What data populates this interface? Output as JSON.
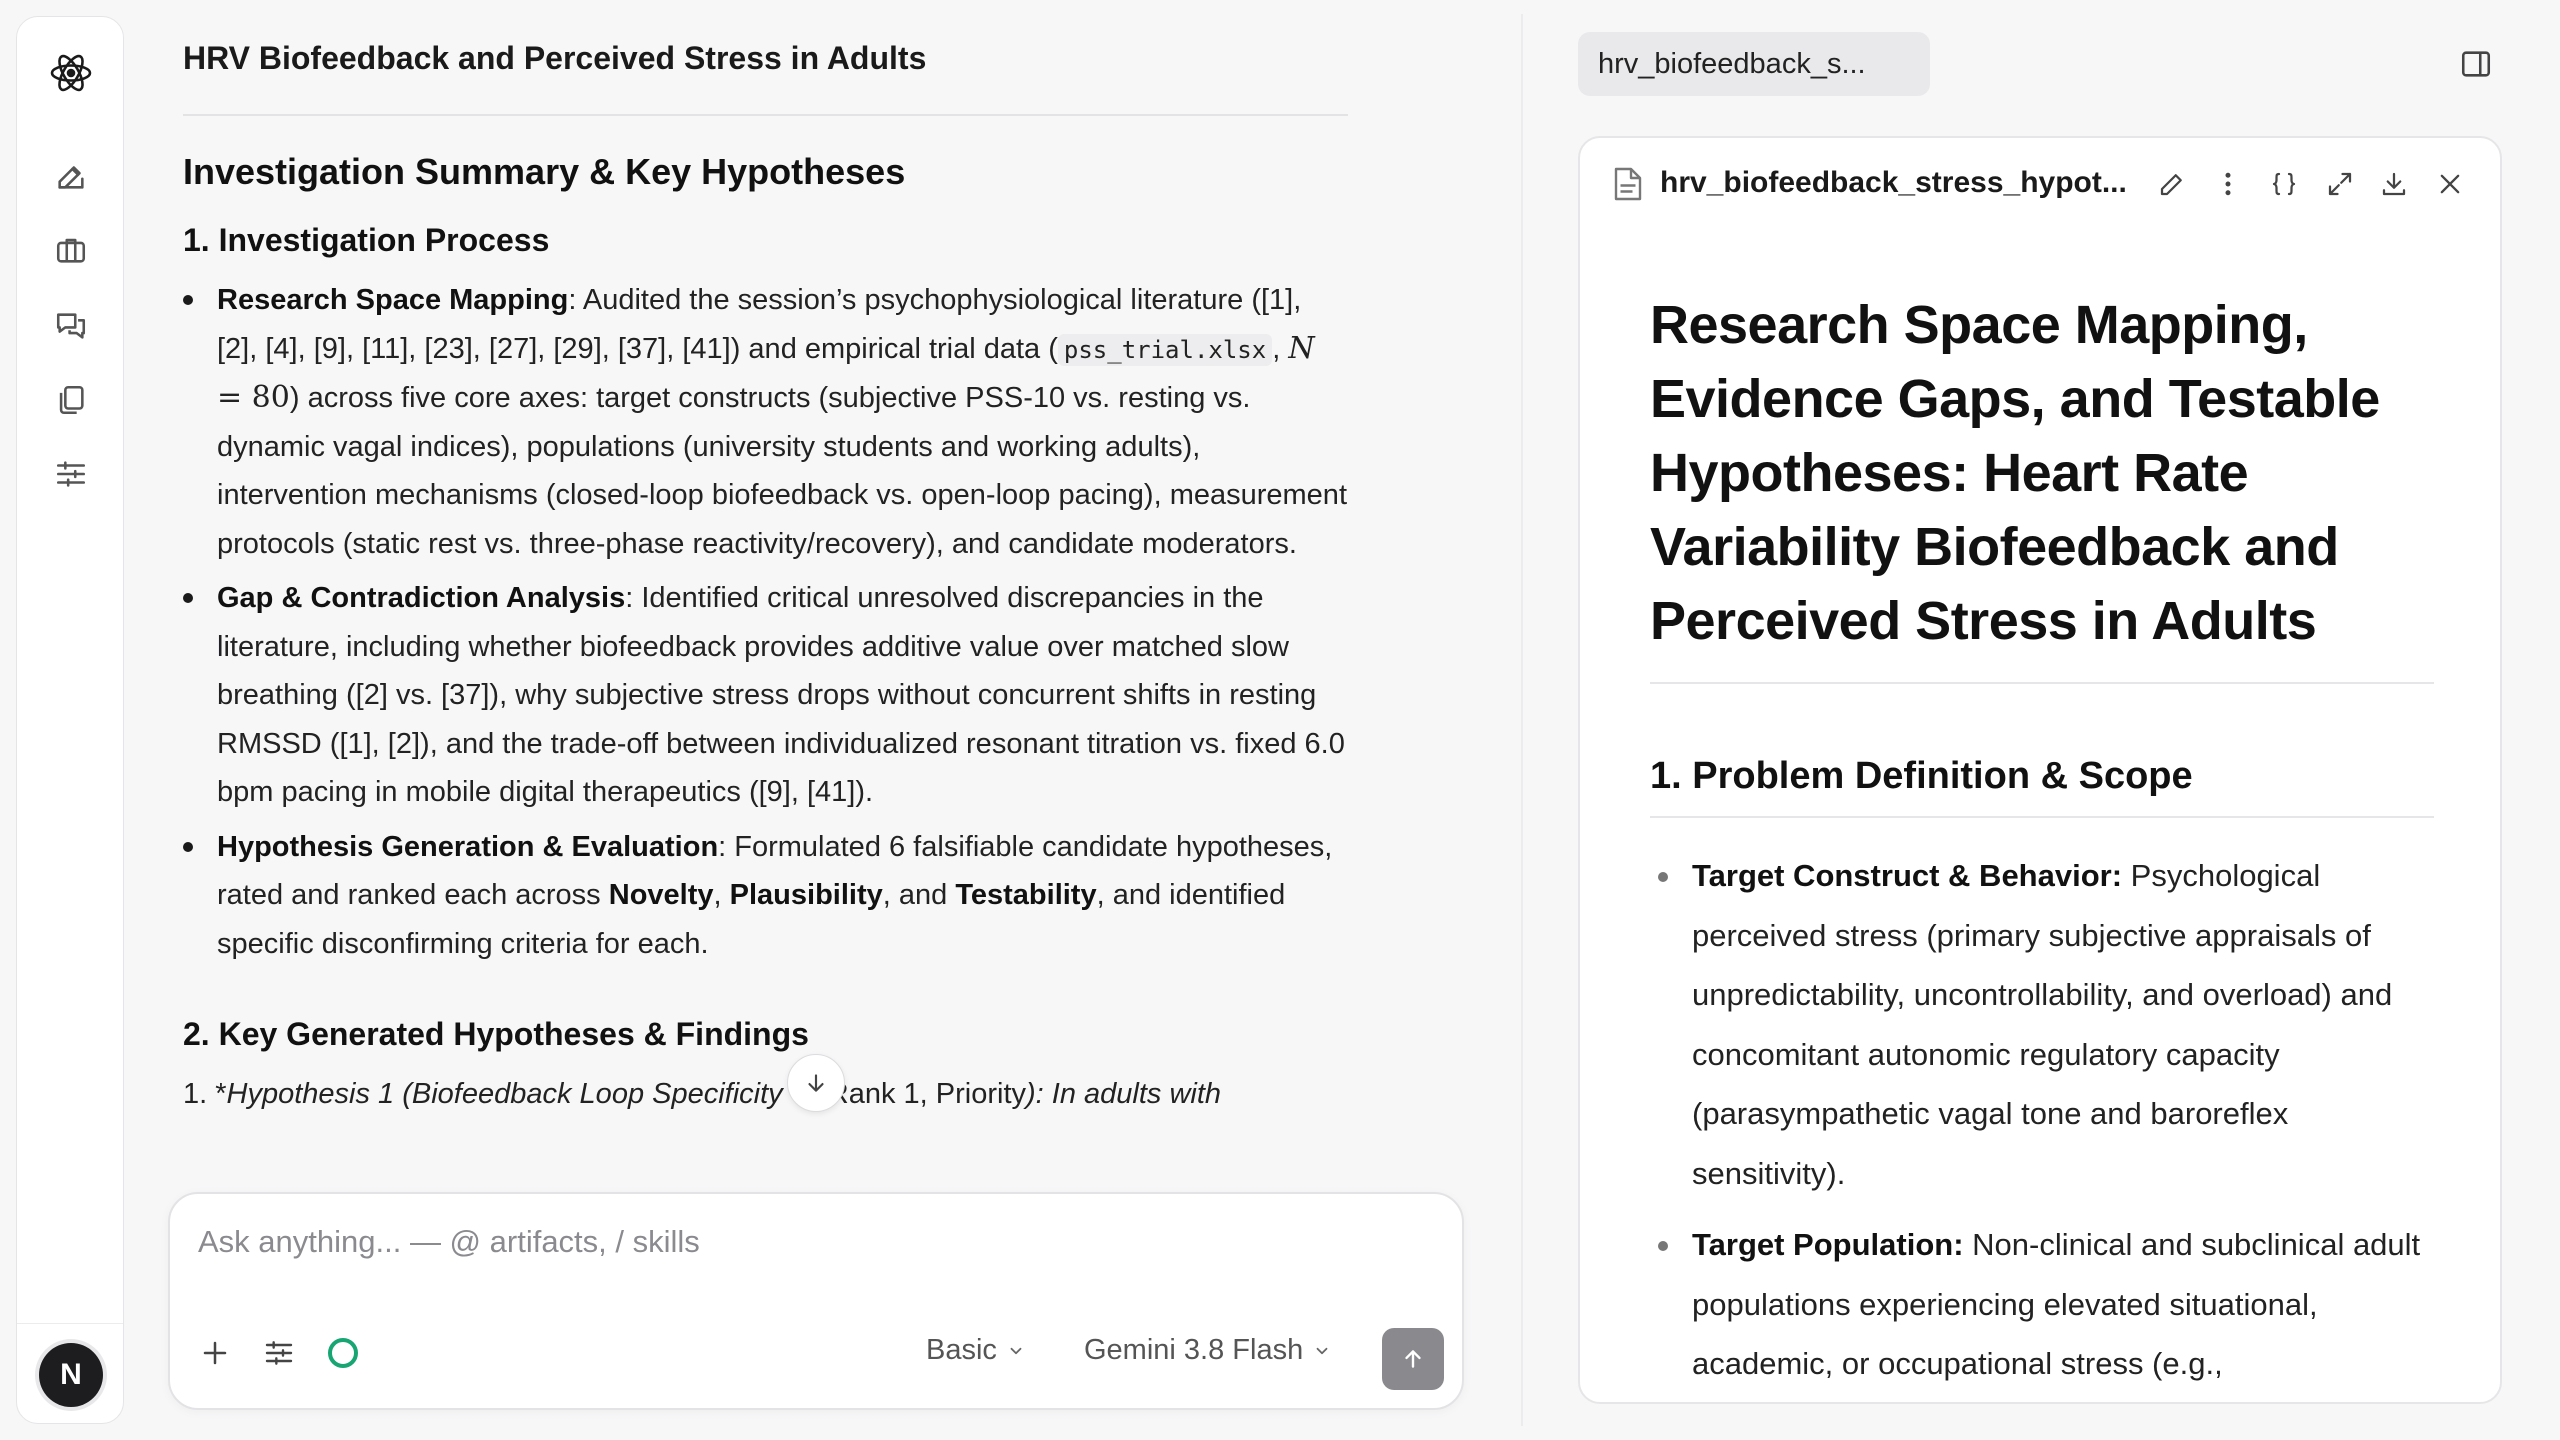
{
  "chat": {
    "title": "HRV Biofeedback and Perceived Stress in Adults",
    "summary_heading": "Investigation Summary & Key Hypotheses",
    "process_heading": "1. Investigation Process",
    "bullets": [
      {
        "label": "Research Space Mapping",
        "text_a": ": Audited the session’s psychophysiological literature ([1], [2], [4], [9], [11], [23], [27], [29], [37], [41]) and empirical trial data (",
        "code": "pss_trial.xlsx",
        "comma": ", ",
        "math_var": "N",
        "math_eq": " = 80",
        "text_b": ") across five core axes: target constructs (subjective PSS-10 vs. resting vs. dynamic vagal indices), populations (university students and working adults), intervention mechanisms (closed-loop biofeedback vs. open-loop pacing), measurement protocols (static rest vs. three-phase reactivity/recovery), and candidate moderators."
      },
      {
        "label": "Gap & Contradiction Analysis",
        "text": ": Identified critical unresolved discrepancies in the literature, including whether biofeedback provides additive value over matched slow breathing ([2] vs. [37]), why subjective stress drops without concurrent shifts in resting RMSSD ([1], [2]), and the trade-off between individualized resonant titration vs. fixed 6.0 bpm pacing in mobile digital therapeutics ([9], [41])."
      },
      {
        "label": "Hypothesis Generation & Evaluation",
        "text_a": ": Formulated 6 falsifiable candidate hypotheses, rated and ranked each across ",
        "k1": "Novelty",
        "sep1": ", ",
        "k2": "Plausibility",
        "sep2": ", and ",
        "k3": "Testability",
        "text_b": ", and identified specific disconfirming criteria for each."
      }
    ],
    "findings_heading": "2. Key Generated Hypotheses & Findings",
    "hyp1_prefix": "1. *",
    "hyp1_italic": "Hypothesis 1 (Biofeedback Loop Specificity",
    "hyp1_mid": " — Rank 1, Priority",
    "hyp1_tail": "): In adults with"
  },
  "composer": {
    "placeholder": "Ask anything... — @ artifacts, / skills",
    "mode_label": "Basic",
    "model_label": "Gemini 3.8 Flash"
  },
  "panel": {
    "tab_label": "hrv_biofeedback_s...",
    "file_name": "hrv_biofeedback_stress_hypot...",
    "doc_title": "Research Space Mapping, Evidence Gaps, and Testable Hypotheses: Heart Rate Variability Biofeedback and Perceived Stress in Adults",
    "section_heading": "1. Problem Definition & Scope",
    "items": [
      {
        "label": "Target Construct & Behavior:",
        "text": " Psychological perceived stress (primary subjective appraisals of unpredictability, uncontrollability, and overload) and concomitant autonomic regulatory capacity (parasympathetic vagal tone and baroreflex sensitivity)."
      },
      {
        "label": "Target Population:",
        "text": " Non-clinical and subclinical adult populations experiencing elevated situational, academic, or occupational stress (e.g.,"
      }
    ]
  },
  "user": {
    "avatar_initial": "N"
  },
  "colors": {
    "accent_status": "#17a673",
    "send_button": "#8a8a8e"
  }
}
